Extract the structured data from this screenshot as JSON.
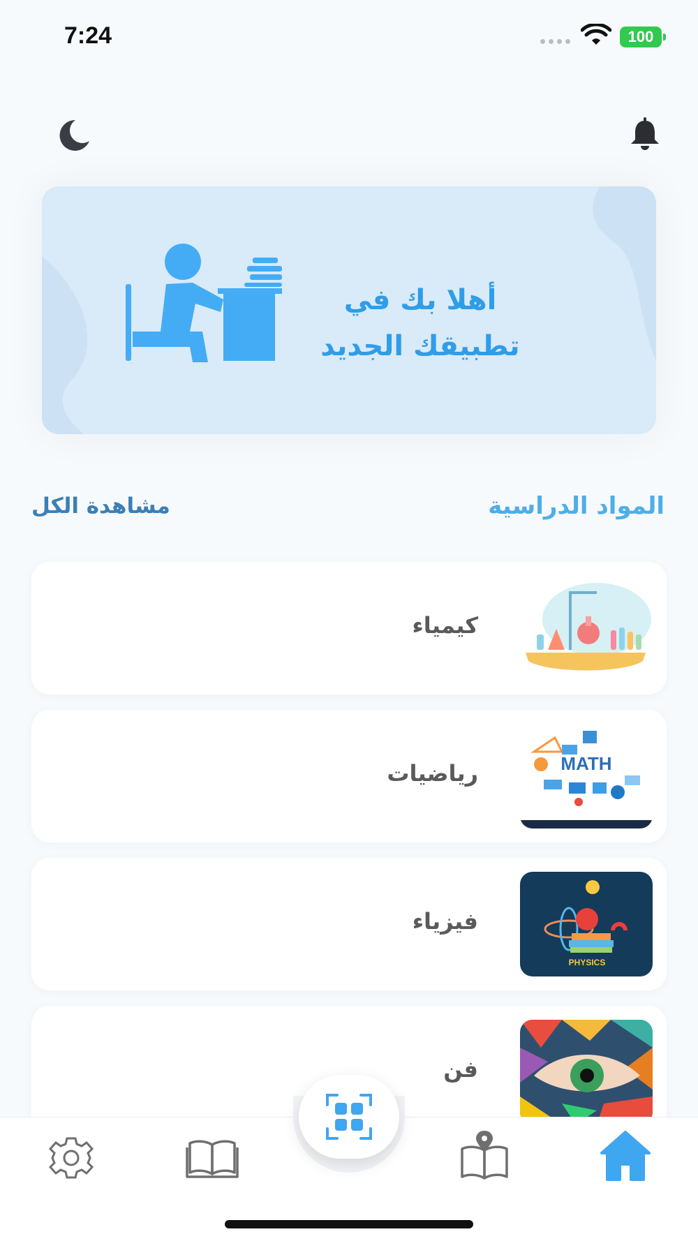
{
  "status_bar": {
    "time": "7:24",
    "battery": "100",
    "icons": [
      "signal-dots-icon",
      "wifi-icon",
      "battery-icon"
    ]
  },
  "header": {
    "left_icon": "moon-icon",
    "right_icon": "bell-icon"
  },
  "banner": {
    "line1": "أهلا بك في",
    "line2": "تطبيقك الجديد",
    "illustration": "student-at-desk-icon",
    "background": "#d9eaf8",
    "accent": "#44acf5"
  },
  "subjects_section": {
    "title": "المواد الدراسية",
    "view_all": "مشاهدة الكل"
  },
  "subjects": [
    {
      "label": "كيمياء",
      "thumbnail": "chemistry-lab-illustration"
    },
    {
      "label": "رياضيات",
      "thumbnail": "math-infographic-illustration",
      "thumb_text": "MATH"
    },
    {
      "label": "فيزياء",
      "thumbnail": "physics-illustration",
      "thumb_text": "PHYSICS"
    },
    {
      "label": "فن",
      "thumbnail": "art-eye-illustration"
    }
  ],
  "bottom_nav": {
    "items": [
      {
        "name": "settings",
        "icon": "gear-icon"
      },
      {
        "name": "library",
        "icon": "open-book-icon"
      },
      {
        "name": "scan",
        "icon": "grid-scan-icon"
      },
      {
        "name": "book-location",
        "icon": "book-pin-icon"
      },
      {
        "name": "home",
        "icon": "home-icon",
        "active": true
      }
    ],
    "active_color": "#3fa6f0",
    "inactive_color": "#6f6f6f"
  }
}
